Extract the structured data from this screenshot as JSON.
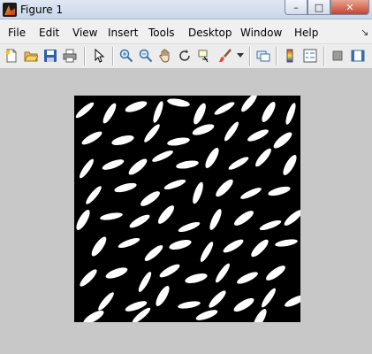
{
  "window": {
    "title": "Figure 1"
  },
  "titlebar_buttons": {
    "minimize": "–",
    "maximize": "□",
    "close": "✕"
  },
  "menu": [
    "File",
    "Edit",
    "View",
    "Insert",
    "Tools",
    "Desktop",
    "Window",
    "Help"
  ],
  "menu_overflow": "↘",
  "toolbar_icons": [
    "new-figure-icon",
    "open-file-icon",
    "save-icon",
    "print-icon",
    "pointer-icon",
    "zoom-in-icon",
    "zoom-out-icon",
    "pan-icon",
    "rotate-3d-icon",
    "data-cursor-icon",
    "brush-icon",
    "link-plot-icon",
    "colorbar-icon",
    "legend-icon",
    "hide-plot-tools-icon",
    "show-plot-tools-icon"
  ],
  "figure": {
    "content": "binary image of white rice grains on black background"
  }
}
